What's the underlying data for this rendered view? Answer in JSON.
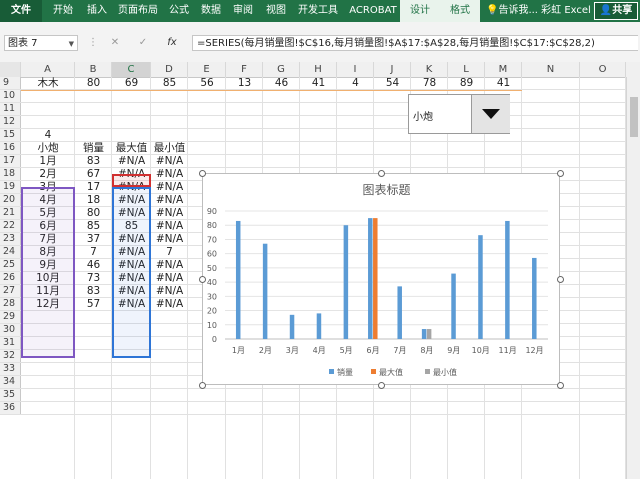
{
  "ribbon": {
    "file": "文件",
    "tabs": [
      "开始",
      "插入",
      "页面布局",
      "公式",
      "数据",
      "审阅",
      "视图",
      "开发工具",
      "ACROBAT"
    ],
    "context_tabs": [
      "设计",
      "格式"
    ],
    "tell_me": "告诉我...",
    "user": "彩虹 Excel",
    "share": "共享"
  },
  "formula_bar": {
    "name_box": "图表 7",
    "cancel": "✕",
    "enter": "✓",
    "fx": "fx",
    "formula": "=SERIES(每月销量图!$C$16,每月销量图!$A$17:$A$28,每月销量图!$C$17:$C$28,2)"
  },
  "columns": [
    "A",
    "B",
    "C",
    "D",
    "E",
    "F",
    "G",
    "H",
    "I",
    "J",
    "K",
    "L",
    "M",
    "N",
    "O"
  ],
  "row_numbers": [
    "9",
    "10",
    "11",
    "12",
    "15",
    "16",
    "17",
    "18",
    "19",
    "20",
    "21",
    "22",
    "23",
    "24",
    "25",
    "26",
    "27",
    "28",
    "29",
    "30",
    "31",
    "32",
    "33",
    "34",
    "35",
    "36"
  ],
  "row9": [
    "木木",
    "80",
    "69",
    "85",
    "56",
    "13",
    "46",
    "41",
    "4",
    "54",
    "78",
    "89",
    "41"
  ],
  "index_cell": "4",
  "table": {
    "headers": [
      "小炮",
      "销量",
      "最大值",
      "最小值"
    ],
    "rows": [
      [
        "1月",
        "83",
        "#N/A",
        "#N/A"
      ],
      [
        "2月",
        "67",
        "#N/A",
        "#N/A"
      ],
      [
        "3月",
        "17",
        "#N/A",
        "#N/A"
      ],
      [
        "4月",
        "18",
        "#N/A",
        "#N/A"
      ],
      [
        "5月",
        "80",
        "#N/A",
        "#N/A"
      ],
      [
        "6月",
        "85",
        "85",
        "#N/A"
      ],
      [
        "7月",
        "37",
        "#N/A",
        "#N/A"
      ],
      [
        "8月",
        "7",
        "#N/A",
        "7"
      ],
      [
        "9月",
        "46",
        "#N/A",
        "#N/A"
      ],
      [
        "10月",
        "73",
        "#N/A",
        "#N/A"
      ],
      [
        "11月",
        "83",
        "#N/A",
        "#N/A"
      ],
      [
        "12月",
        "57",
        "#N/A",
        "#N/A"
      ]
    ]
  },
  "combo": {
    "value": "小炮"
  },
  "colors": {
    "ribbon": "#217346",
    "sales": "#5b9bd5",
    "max": "#ed7d31",
    "min": "#a5a5a5"
  },
  "chart_data": {
    "type": "bar",
    "title": "图表标题",
    "categories": [
      "1月",
      "2月",
      "3月",
      "4月",
      "5月",
      "6月",
      "7月",
      "8月",
      "9月",
      "10月",
      "11月",
      "12月"
    ],
    "series": [
      {
        "name": "销量",
        "values": [
          83,
          67,
          17,
          18,
          80,
          85,
          37,
          7,
          46,
          73,
          83,
          57
        ]
      },
      {
        "name": "最大值",
        "values": [
          null,
          null,
          null,
          null,
          null,
          85,
          null,
          null,
          null,
          null,
          null,
          null
        ]
      },
      {
        "name": "最小值",
        "values": [
          null,
          null,
          null,
          null,
          null,
          null,
          null,
          7,
          null,
          null,
          null,
          null
        ]
      }
    ],
    "ylim": [
      0,
      90
    ],
    "yticks": [
      "0",
      "10",
      "20",
      "30",
      "40",
      "50",
      "60",
      "70",
      "80",
      "90"
    ],
    "grid": true,
    "legend": "bottom"
  }
}
